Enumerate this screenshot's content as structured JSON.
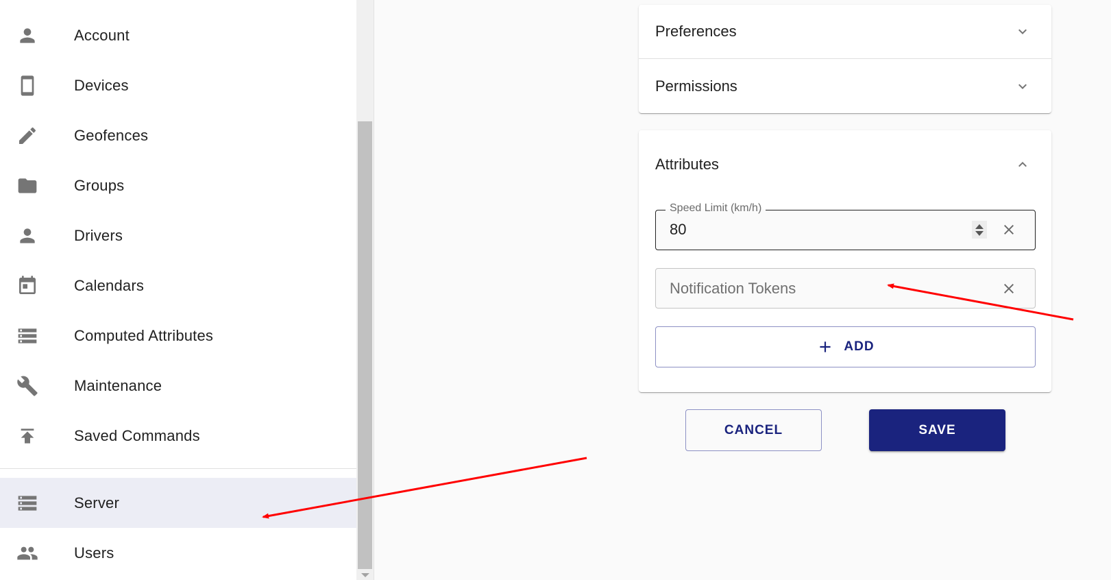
{
  "sidebar": {
    "items": [
      {
        "label": "Account",
        "icon": "person-icon"
      },
      {
        "label": "Devices",
        "icon": "smartphone-icon"
      },
      {
        "label": "Geofences",
        "icon": "pencil-icon"
      },
      {
        "label": "Groups",
        "icon": "folder-icon"
      },
      {
        "label": "Drivers",
        "icon": "person-icon"
      },
      {
        "label": "Calendars",
        "icon": "calendar-icon"
      },
      {
        "label": "Computed Attributes",
        "icon": "storage-icon"
      },
      {
        "label": "Maintenance",
        "icon": "wrench-icon"
      },
      {
        "label": "Saved Commands",
        "icon": "publish-icon"
      }
    ],
    "admin_items": [
      {
        "label": "Server",
        "icon": "storage-icon",
        "selected": true
      },
      {
        "label": "Users",
        "icon": "people-icon"
      }
    ]
  },
  "sections": {
    "preferences": {
      "title": "Preferences",
      "expanded": false
    },
    "permissions": {
      "title": "Permissions",
      "expanded": false
    },
    "attributes": {
      "title": "Attributes",
      "expanded": true,
      "speed_limit": {
        "label": "Speed Limit (km/h)",
        "value": "80"
      },
      "notification_tokens": {
        "placeholder": "Notification Tokens",
        "value": ""
      },
      "add_label": "ADD"
    }
  },
  "actions": {
    "cancel_label": "CANCEL",
    "save_label": "SAVE"
  },
  "colors": {
    "primary": "#1a237e",
    "selected_bg": "#ecedf5",
    "annotation_arrow": "#ff0000"
  }
}
